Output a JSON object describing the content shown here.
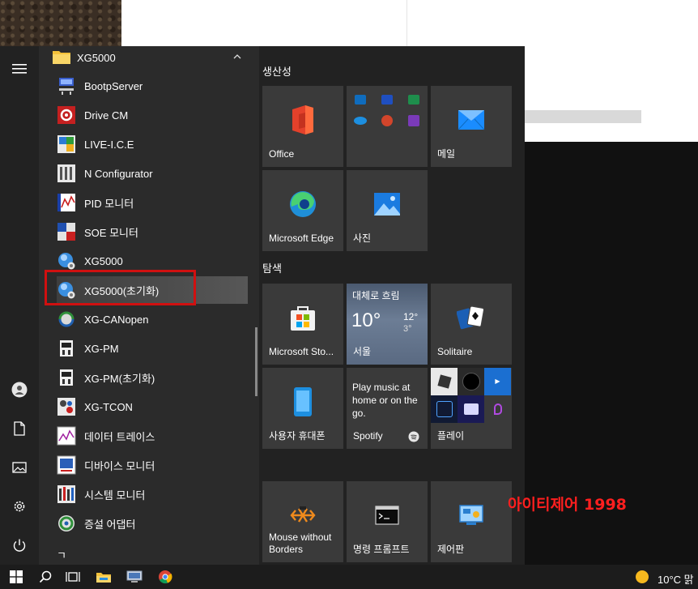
{
  "watermark": "아이티제어 1998",
  "app_list": {
    "folder": "XG5000",
    "items": [
      {
        "label": "BootpServer",
        "icon": "server-icon"
      },
      {
        "label": "Drive CM",
        "icon": "drive-cm-icon"
      },
      {
        "label": "LIVE-I.C.E",
        "icon": "live-ice-icon"
      },
      {
        "label": "N Configurator",
        "icon": "n-configurator-icon"
      },
      {
        "label": "PID 모니터",
        "icon": "pid-monitor-icon"
      },
      {
        "label": "SOE 모니터",
        "icon": "soe-monitor-icon"
      },
      {
        "label": "XG5000",
        "icon": "xg5000-icon"
      },
      {
        "label": "XG5000(초기화)",
        "icon": "xg5000-init-icon"
      },
      {
        "label": "XG-CANopen",
        "icon": "xg-canopen-icon"
      },
      {
        "label": "XG-PM",
        "icon": "xg-pm-icon"
      },
      {
        "label": "XG-PM(초기화)",
        "icon": "xg-pm-init-icon"
      },
      {
        "label": "XG-TCON",
        "icon": "xg-tcon-icon"
      },
      {
        "label": "데이터 트레이스",
        "icon": "data-trace-icon"
      },
      {
        "label": "디바이스 모니터",
        "icon": "device-monitor-icon"
      },
      {
        "label": "시스템 모니터",
        "icon": "system-monitor-icon"
      },
      {
        "label": "증설 어댑터",
        "icon": "adapter-icon"
      }
    ],
    "bottom_letter": "ㄱ"
  },
  "groups": {
    "productivity": "생산성",
    "explore": "탐색"
  },
  "tiles": {
    "office": "Office",
    "mail": "메일",
    "edge": "Microsoft Edge",
    "photos": "사진",
    "store": "Microsoft Sto...",
    "weather": {
      "condition": "대체로 흐림",
      "temp": "10°",
      "hi": "12°",
      "lo": "3°",
      "city": "서울"
    },
    "solitaire": "Solitaire",
    "phone": "사용자 휴대폰",
    "spotify": {
      "text": "Play music at home or on the go.",
      "name": "Spotify"
    },
    "play": "플레이",
    "mouse": "Mouse without Borders",
    "cmd": "명령 프롬프트",
    "control": "제어판"
  },
  "taskbar": {
    "temperature": "10°C 맑"
  },
  "colors": {
    "highlight": "#d01010",
    "tile": "#3a3a3a",
    "accent_blue": "#0a6ed1"
  }
}
